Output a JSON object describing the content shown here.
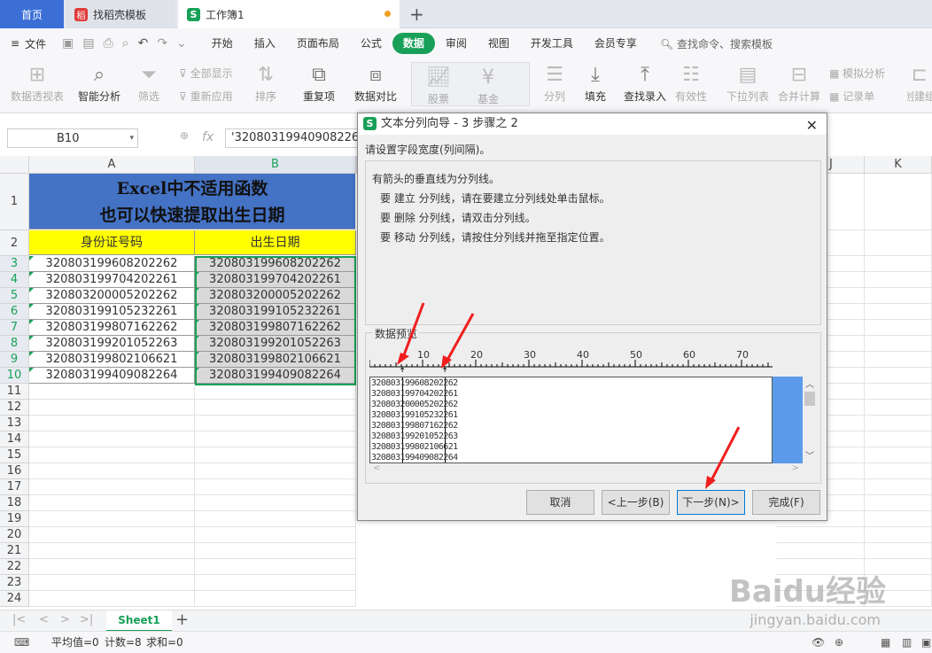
{
  "tabs": {
    "home": "首页",
    "doc": "找稻壳模板",
    "book": "工作簿1"
  },
  "menu": {
    "file": "文件",
    "items": [
      "开始",
      "插入",
      "页面布局",
      "公式",
      "数据",
      "审阅",
      "视图",
      "开发工具",
      "会员专享"
    ],
    "active": "数据",
    "search": "查找命令、搜索模板"
  },
  "ribbon": {
    "pivot": "数据透视表",
    "smart": "智能分析",
    "filter": "筛选",
    "show_all": "全部显示",
    "reapply": "重新应用",
    "sort": "排序",
    "dup": "重复项",
    "compare": "数据对比",
    "stock": "股票",
    "fund": "基金",
    "split": "分列",
    "fill": "填充",
    "lookup": "查找录入",
    "validity": "有效性",
    "dropdown": "下拉列表",
    "merge_calc": "合并计算",
    "simulate": "模拟分析",
    "record": "记录单",
    "create": "创建组"
  },
  "formula": {
    "cell_ref": "B10",
    "fx": "fx",
    "content": "'320803199409082264"
  },
  "sheet": {
    "columns": [
      "A",
      "B",
      "I",
      "J",
      "K"
    ],
    "title_line1": "Excel中不适用函数",
    "title_line2": "也可以快速提取出生日期",
    "header_a": "身份证号码",
    "header_b": "出生日期",
    "ids": [
      "320803199608202262",
      "320803199704202261",
      "320803200005202262",
      "320803199105232261",
      "320803199807162262",
      "320803199201052263",
      "320803199802106621",
      "320803199409082264"
    ],
    "rows": [
      "1",
      "2",
      "3",
      "4",
      "5",
      "6",
      "7",
      "8",
      "9",
      "10",
      "11",
      "12",
      "13",
      "14",
      "15",
      "16",
      "17",
      "18",
      "19",
      "20",
      "21",
      "22",
      "23",
      "24"
    ],
    "tab": "Sheet1"
  },
  "status": {
    "avg": "平均值=0",
    "count": "计数=8",
    "sum": "求和=0"
  },
  "dialog": {
    "title": "文本分列向导 - 3 步骤之 2",
    "prompt": "请设置字段宽度(列间隔)。",
    "line1": "有箭头的垂直线为分列线。",
    "line2": "要 建立 分列线，请在要建立分列线处单击鼠标。",
    "line3": "要 删除 分列线，请双击分列线。",
    "line4": "要 移动 分列线，请按住分列线并拖至指定位置。",
    "preview_label": "数据预览",
    "ruler": [
      "10",
      "20",
      "30",
      "40",
      "50",
      "60",
      "70"
    ],
    "preview": [
      "320803199608202262",
      "320803199704202261",
      "320803200005202262",
      "320803199105232261",
      "320803199807162262",
      "320803199201052263",
      "320803199802106621",
      "320803199409082264"
    ],
    "btn_cancel": "取消",
    "btn_prev": "<上一步(B)",
    "btn_next": "下一步(N)>",
    "btn_finish": "完成(F)"
  },
  "watermark": {
    "brand": "Baidu经验",
    "url": "jingyan.baidu.com"
  }
}
